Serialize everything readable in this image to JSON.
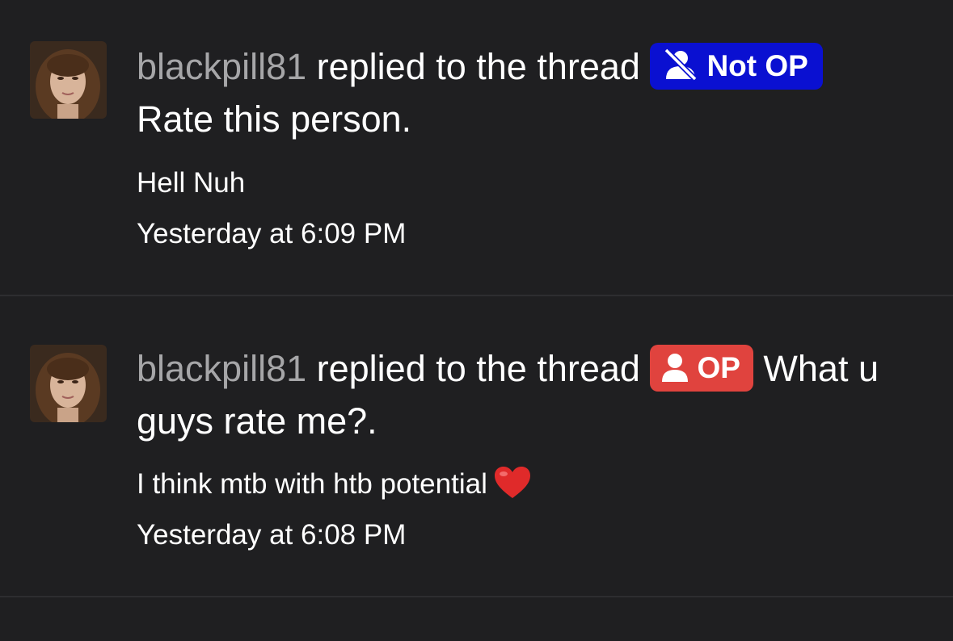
{
  "items": [
    {
      "username": "blackpill81",
      "action": "replied to the thread",
      "badge": {
        "label": "Not OP",
        "icon": "user-slash-icon",
        "color": "#0a10d1"
      },
      "thread_title": "Rate this person.",
      "snippet": "Hell Nuh",
      "time": "Yesterday at 6:09 PM"
    },
    {
      "username": "blackpill81",
      "action": "replied to the thread",
      "badge": {
        "label": "OP",
        "icon": "user-icon",
        "color": "#e0433e"
      },
      "thread_title": "What u guys rate me?.",
      "snippet": "I think mtb with htb potential",
      "snippet_emoji": "heart-emoji",
      "time": "Yesterday at 6:08 PM"
    }
  ],
  "colors": {
    "background": "#1f1f21",
    "username": "#a6a6a8",
    "divider": "#2d2d30"
  }
}
